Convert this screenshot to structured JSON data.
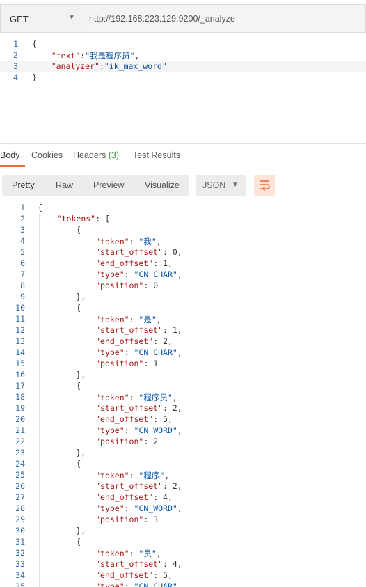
{
  "request": {
    "method": "GET",
    "url": "http://192.168.223.129:9200/_analyze"
  },
  "request_body": {
    "lines": [
      {
        "num": "1",
        "text": "{"
      },
      {
        "num": "2",
        "text": "    \"text\":\"我是程序员\","
      },
      {
        "num": "3",
        "text": "    \"analyzer\":\"ik_max_word\""
      },
      {
        "num": "4",
        "text": "}"
      }
    ]
  },
  "response_tabs": {
    "body": "Body",
    "cookies": "Cookies",
    "headers": "Headers",
    "headers_count": "(3)",
    "test_results": "Test Results"
  },
  "view_modes": {
    "pretty": "Pretty",
    "raw": "Raw",
    "preview": "Preview",
    "visualize": "Visualize",
    "format": "JSON"
  },
  "response_body": {
    "lines": [
      {
        "num": "1",
        "text": "{"
      },
      {
        "num": "2",
        "text": "    \"tokens\": ["
      },
      {
        "num": "3",
        "text": "        {"
      },
      {
        "num": "4",
        "text": "            \"token\": \"我\","
      },
      {
        "num": "5",
        "text": "            \"start_offset\": 0,"
      },
      {
        "num": "6",
        "text": "            \"end_offset\": 1,"
      },
      {
        "num": "7",
        "text": "            \"type\": \"CN_CHAR\","
      },
      {
        "num": "8",
        "text": "            \"position\": 0"
      },
      {
        "num": "9",
        "text": "        },"
      },
      {
        "num": "10",
        "text": "        {"
      },
      {
        "num": "11",
        "text": "            \"token\": \"是\","
      },
      {
        "num": "12",
        "text": "            \"start_offset\": 1,"
      },
      {
        "num": "13",
        "text": "            \"end_offset\": 2,"
      },
      {
        "num": "14",
        "text": "            \"type\": \"CN_CHAR\","
      },
      {
        "num": "15",
        "text": "            \"position\": 1"
      },
      {
        "num": "16",
        "text": "        },"
      },
      {
        "num": "17",
        "text": "        {"
      },
      {
        "num": "18",
        "text": "            \"token\": \"程序员\","
      },
      {
        "num": "19",
        "text": "            \"start_offset\": 2,"
      },
      {
        "num": "20",
        "text": "            \"end_offset\": 5,"
      },
      {
        "num": "21",
        "text": "            \"type\": \"CN_WORD\","
      },
      {
        "num": "22",
        "text": "            \"position\": 2"
      },
      {
        "num": "23",
        "text": "        },"
      },
      {
        "num": "24",
        "text": "        {"
      },
      {
        "num": "25",
        "text": "            \"token\": \"程序\","
      },
      {
        "num": "26",
        "text": "            \"start_offset\": 2,"
      },
      {
        "num": "27",
        "text": "            \"end_offset\": 4,"
      },
      {
        "num": "28",
        "text": "            \"type\": \"CN_WORD\","
      },
      {
        "num": "29",
        "text": "            \"position\": 3"
      },
      {
        "num": "30",
        "text": "        },"
      },
      {
        "num": "31",
        "text": "        {"
      },
      {
        "num": "32",
        "text": "            \"token\": \"员\","
      },
      {
        "num": "33",
        "text": "            \"start_offset\": 4,"
      },
      {
        "num": "34",
        "text": "            \"end_offset\": 5,"
      },
      {
        "num": "35",
        "text": "            \"type\": \"CN_CHAR\","
      }
    ]
  },
  "colors": {
    "accent": "#f26b3a",
    "line_number": "#2f6aa5",
    "json_key": "#a31515",
    "json_string": "#0451a5",
    "count_green": "#3a9d3a"
  },
  "icons": {
    "method_dropdown": "chevron-down-icon",
    "format_dropdown": "chevron-down-icon",
    "wrap": "wrap-lines-icon"
  }
}
